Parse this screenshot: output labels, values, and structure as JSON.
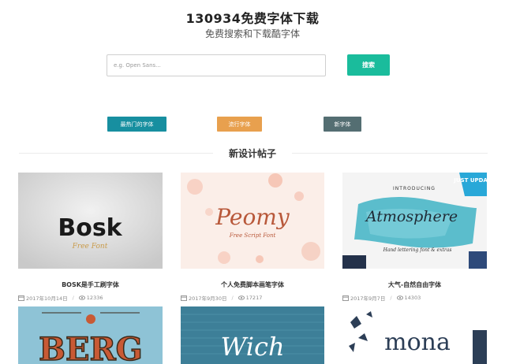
{
  "header": {
    "title": "130934免费字体下载",
    "subtitle": "免费搜索和下载酷字体"
  },
  "search": {
    "placeholder": "e.g. Open Sans...",
    "value": "",
    "button_label": "搜索"
  },
  "filters": [
    {
      "label": "最热门的字体",
      "color": "#178fa0"
    },
    {
      "label": "流行字体",
      "color": "#e8a04e"
    },
    {
      "label": "新字体",
      "color": "#546e72"
    }
  ],
  "section": {
    "title": "新设计帖子"
  },
  "posts": [
    {
      "title": "BOSK是手工刷字体",
      "date": "2017年10月14日",
      "views": "12336",
      "thumb_text": "Bosk",
      "thumb_sub": "Free Font"
    },
    {
      "title": "个人免费脚本画笔字体",
      "date": "2017年9月30日",
      "views": "17217",
      "thumb_text": "Peomy",
      "thumb_sub": "Free Script Font"
    },
    {
      "title": "大气-自然自由字体",
      "date": "2017年9月7日",
      "views": "14303",
      "thumb_text": "Atmosphere",
      "thumb_top": "INTRODUCING",
      "thumb_sub": "Hand lettering font & extras",
      "badge": "JUST UPDATED"
    },
    {
      "thumb_text": "BERG"
    },
    {
      "thumb_text": "Wich"
    },
    {
      "thumb_text": "mona"
    }
  ],
  "colors": {
    "accent": "#1abc9c"
  }
}
